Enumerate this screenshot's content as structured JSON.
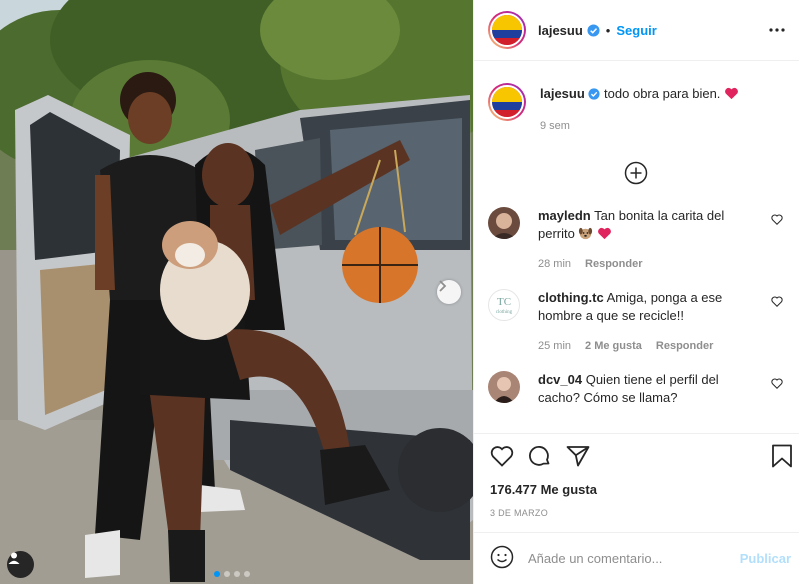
{
  "post": {
    "username": "lajesuu",
    "follow_label": "Seguir",
    "bullet": "•",
    "more_icon": "more-options-icon"
  },
  "caption": {
    "username": "lajesuu",
    "text": "todo obra para bien.",
    "emoji": "heart-emoji",
    "time": "9 sem"
  },
  "comments": [
    {
      "username": "mayledn",
      "text": "Tan bonita la carita del perrito",
      "time": "28 min",
      "reply_label": "Responder"
    },
    {
      "username": "clothing.tc",
      "text": "Amiga, ponga a ese hombre a que se recicle!!",
      "time": "25 min",
      "likes": "2 Me gusta",
      "reply_label": "Responder"
    },
    {
      "username": "dcv_04",
      "text": "Quien tiene el perfil del cacho? Cómo se llama?"
    }
  ],
  "stats": {
    "likes": "176.477 Me gusta",
    "date": "3 de marzo"
  },
  "composer": {
    "placeholder": "Añade un comentario...",
    "publish_label": "Publicar"
  },
  "carousel": {
    "slides": 4,
    "active": 1
  },
  "colors": {
    "accent": "#0095f6",
    "publish_disabled": "#b2dffc",
    "heart": "#ed4956",
    "verified": "#3897f0"
  }
}
